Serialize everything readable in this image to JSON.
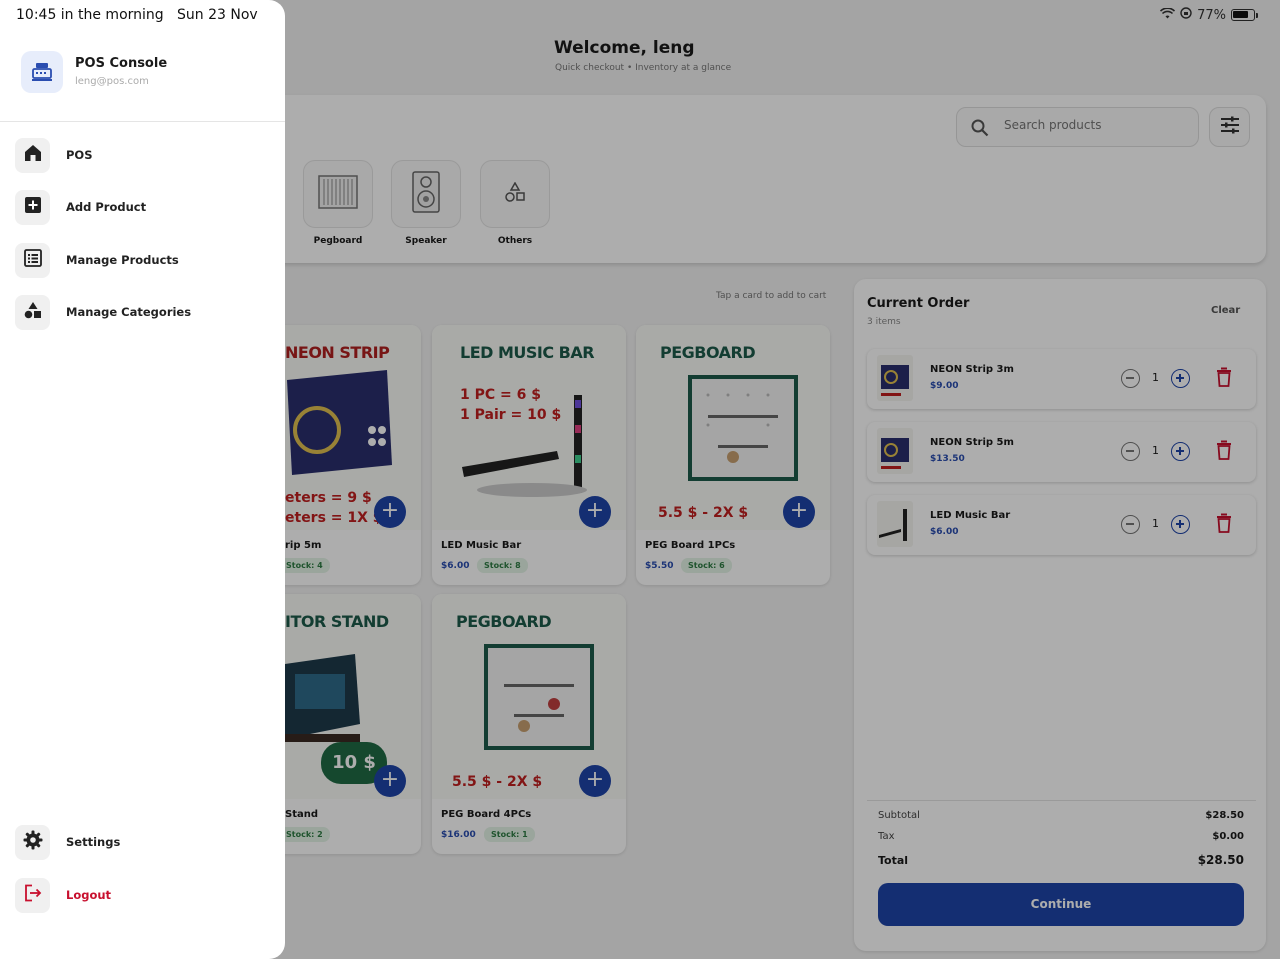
{
  "status_bar": {
    "time": "10:45 in the morning",
    "date": "Sun 23 Nov",
    "battery": "77%"
  },
  "header": {
    "welcome": "Welcome, leng",
    "subtitle": "Quick checkout • Inventory at a glance"
  },
  "search": {
    "placeholder": "Search products"
  },
  "categories": [
    {
      "label": "Pegboard",
      "icon": "pegboard-icon"
    },
    {
      "label": "Speaker",
      "icon": "speaker-icon"
    },
    {
      "label": "Others",
      "icon": "shapes-icon"
    }
  ],
  "products_hint": "Tap a card to add to cart",
  "products": [
    {
      "name": "rip 5m",
      "price": "",
      "stock": "Stock: 4",
      "art_title": "NEON STRIP",
      "art_line1": "eters = 9 $",
      "art_line2": "eters = 1X $"
    },
    {
      "name": "LED Music Bar",
      "price": "$6.00",
      "stock": "Stock: 8",
      "art_title": "LED MUSIC BAR",
      "art_line1": "1 PC = 6 $",
      "art_line2": "1 Pair = 10 $"
    },
    {
      "name": "PEG Board 1PCs",
      "price": "$5.50",
      "stock": "Stock: 6",
      "art_title": "PEGBOARD",
      "art_line1": "5.5 $ - 2X $"
    },
    {
      "name": "Stand",
      "price": "",
      "stock": "Stock: 2",
      "art_title": "ITOR STAND",
      "art_line1": "10 $"
    },
    {
      "name": "PEG Board 4PCs",
      "price": "$16.00",
      "stock": "Stock: 1",
      "art_title": "PEGBOARD",
      "art_line1": "5.5 $ - 2X $"
    }
  ],
  "order": {
    "title": "Current Order",
    "count": "3 items",
    "clear_label": "Clear",
    "items": [
      {
        "name": "NEON Strip 3m",
        "price": "$9.00",
        "qty": "1"
      },
      {
        "name": "NEON Strip 5m",
        "price": "$13.50",
        "qty": "1"
      },
      {
        "name": "LED Music Bar",
        "price": "$6.00",
        "qty": "1"
      }
    ],
    "subtotal_label": "Subtotal",
    "subtotal": "$28.50",
    "tax_label": "Tax",
    "tax": "$0.00",
    "total_label": "Total",
    "total": "$28.50",
    "continue_label": "Continue"
  },
  "drawer": {
    "app_title": "POS Console",
    "email": "leng@pos.com",
    "items": [
      {
        "label": "POS",
        "icon": "home-icon"
      },
      {
        "label": "Add Product",
        "icon": "add-box-icon"
      },
      {
        "label": "Manage Products",
        "icon": "list-icon"
      },
      {
        "label": "Manage Categories",
        "icon": "category-icon"
      }
    ],
    "settings_label": "Settings",
    "logout_label": "Logout"
  },
  "colors": {
    "primary": "#1e44a8",
    "danger": "#c8102e",
    "stock_green": "#2f7d44"
  }
}
